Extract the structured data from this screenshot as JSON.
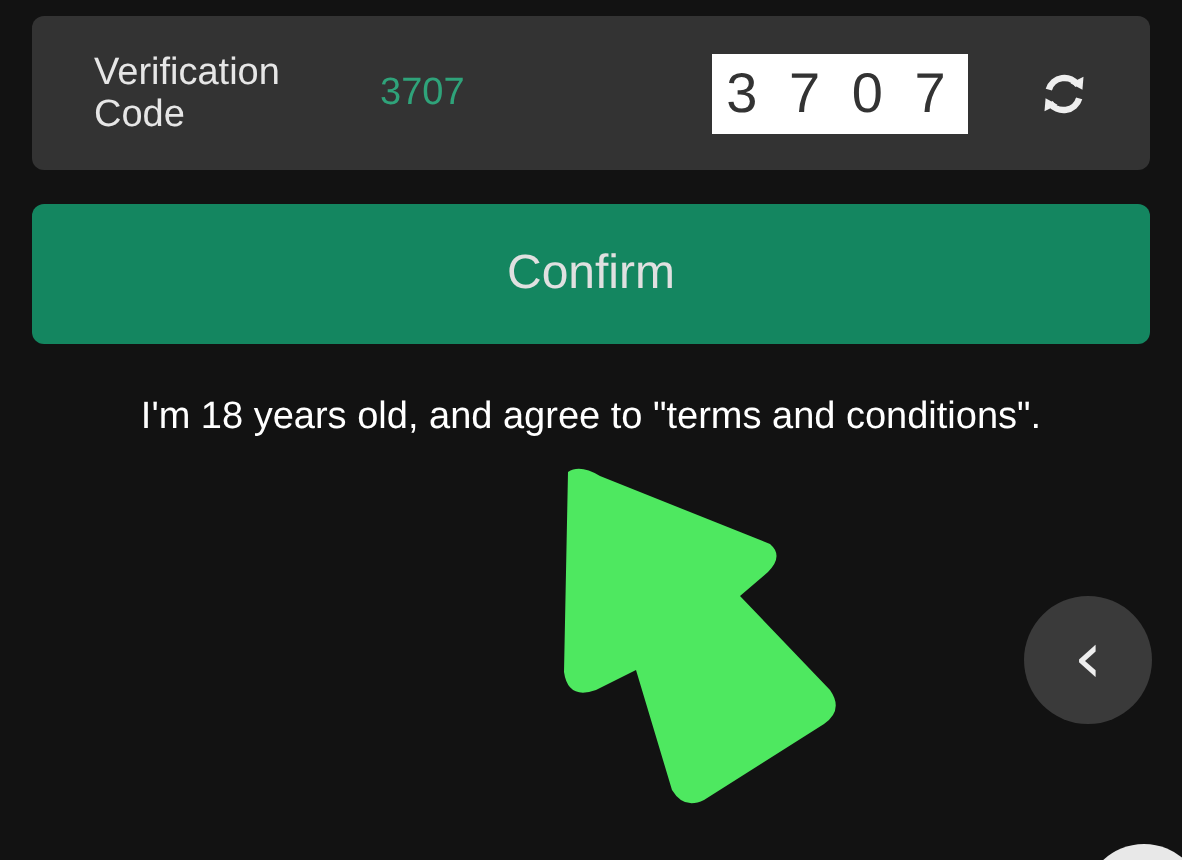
{
  "verification": {
    "label": "Verification Code",
    "code": "3707",
    "captcha": "3 7 0 7"
  },
  "confirm_button": "Confirm",
  "agreement": "I'm 18 years old, and agree to \"terms and conditions\".",
  "back_button": "‹"
}
